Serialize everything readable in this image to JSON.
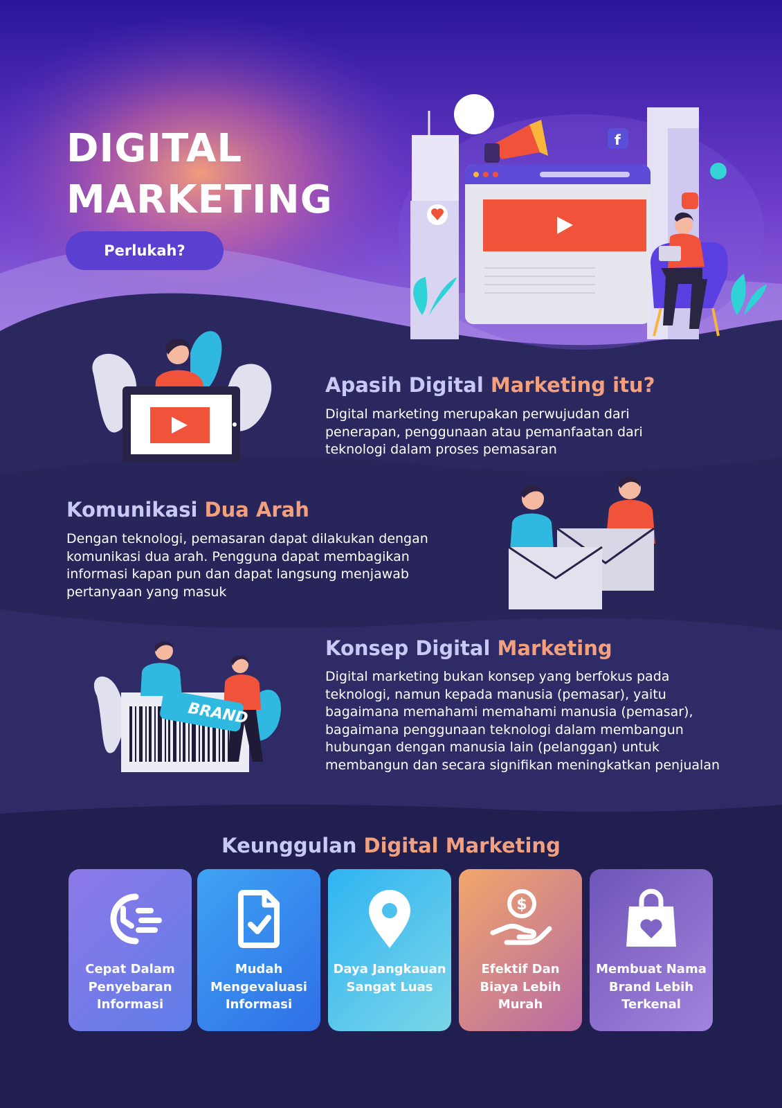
{
  "hero": {
    "title_line1": "DIGITAL",
    "title_line2": "MARKETING",
    "button_label": "Perlukah?"
  },
  "sections": [
    {
      "title_part1": "Apasih Digital",
      "title_part2": "Marketing itu?",
      "body": "Digital marketing merupakan perwujudan dari penerapan, penggunaan atau pemanfaatan dari teknologi dalam proses pemasaran"
    },
    {
      "title_part1": "Komunikasi",
      "title_part2": "Dua Arah",
      "body": "Dengan teknologi, pemasaran dapat dilakukan dengan komunikasi dua arah. Pengguna dapat membagikan informasi kapan pun dan dapat langsung menjawab pertanyaan yang masuk"
    },
    {
      "title_part1": "Konsep Digital",
      "title_part2": "Marketing",
      "body": "Digital marketing bukan konsep yang berfokus pada teknologi, namun kepada manusia (pemasar), yaitu bagaimana memahami memahami manusia (pemasar), bagaimana penggunaan teknologi dalam membangun hubungan dengan manusia lain (pelanggan) untuk membangun dan secara signifikan meningkatkan penjualan"
    }
  ],
  "brand_tag": "BRAND",
  "advantages": {
    "title_part1": "Keunggulan",
    "title_part2": "Digital Marketing",
    "cards": [
      {
        "label": "Cepat Dalam Penyebaran Informasi",
        "icon": "fast-clock-icon"
      },
      {
        "label": "Mudah Mengevaluasi Informasi",
        "icon": "document-check-icon"
      },
      {
        "label": "Daya Jangkauan Sangat Luas",
        "icon": "location-pin-icon"
      },
      {
        "label": "Efektif Dan Biaya Lebih Murah",
        "icon": "money-hand-icon"
      },
      {
        "label": "Membuat Nama Brand Lebih Terkenal",
        "icon": "shopping-bag-heart-icon"
      }
    ]
  },
  "colors": {
    "background": "#232453",
    "hero_top": "#2c1aa0",
    "accent_peach": "#f2a07e",
    "accent_lavender": "#c9c9f5",
    "button": "#5a3fd0",
    "orange_red": "#f0533a"
  }
}
